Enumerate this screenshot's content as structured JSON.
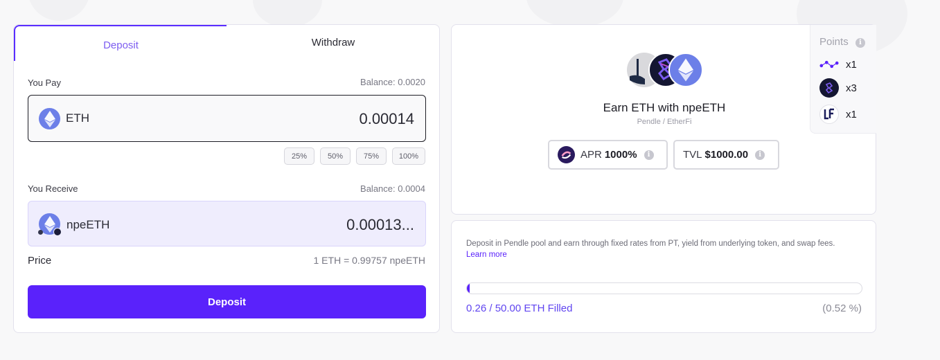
{
  "tabs": {
    "deposit": "Deposit",
    "withdraw": "Withdraw"
  },
  "pay": {
    "label": "You Pay",
    "balance": "Balance: 0.0020",
    "token": "ETH",
    "amount": "0.00014",
    "percent_buttons": [
      "25%",
      "50%",
      "75%",
      "100%"
    ]
  },
  "receive": {
    "label": "You Receive",
    "balance": "Balance: 0.0004",
    "token": "npeETH",
    "amount": "0.00013..."
  },
  "price": {
    "label": "Price",
    "value": "1 ETH = 0.99757 npeETH"
  },
  "deposit_button": "Deposit",
  "vault": {
    "title": "Earn ETH with npeETH",
    "subtitle": "Pendle / EtherFi",
    "apr_label": "APR",
    "apr_value": "1000%",
    "tvl_label": "TVL",
    "tvl_value": "$1000.00"
  },
  "points": {
    "title": "Points",
    "items": [
      {
        "icon": "dots-network-icon",
        "multiplier": "x1"
      },
      {
        "icon": "etherfi-logo-icon",
        "multiplier": "x3"
      },
      {
        "icon": "lf-logo-icon",
        "multiplier": "x1"
      }
    ]
  },
  "info": {
    "description": "Deposit in Pendle pool and earn through fixed rates from PT, yield from underlying token, and swap fees.",
    "learn_more": "Learn more",
    "progress_fraction": 0.0052,
    "filled_text": "0.26 / 50.00 ETH Filled",
    "filled_pct": "(0.52 %)"
  },
  "colors": {
    "accent": "#5a22fb",
    "accent_text": "#7c5cf0",
    "eth": "#6c7fe8"
  }
}
